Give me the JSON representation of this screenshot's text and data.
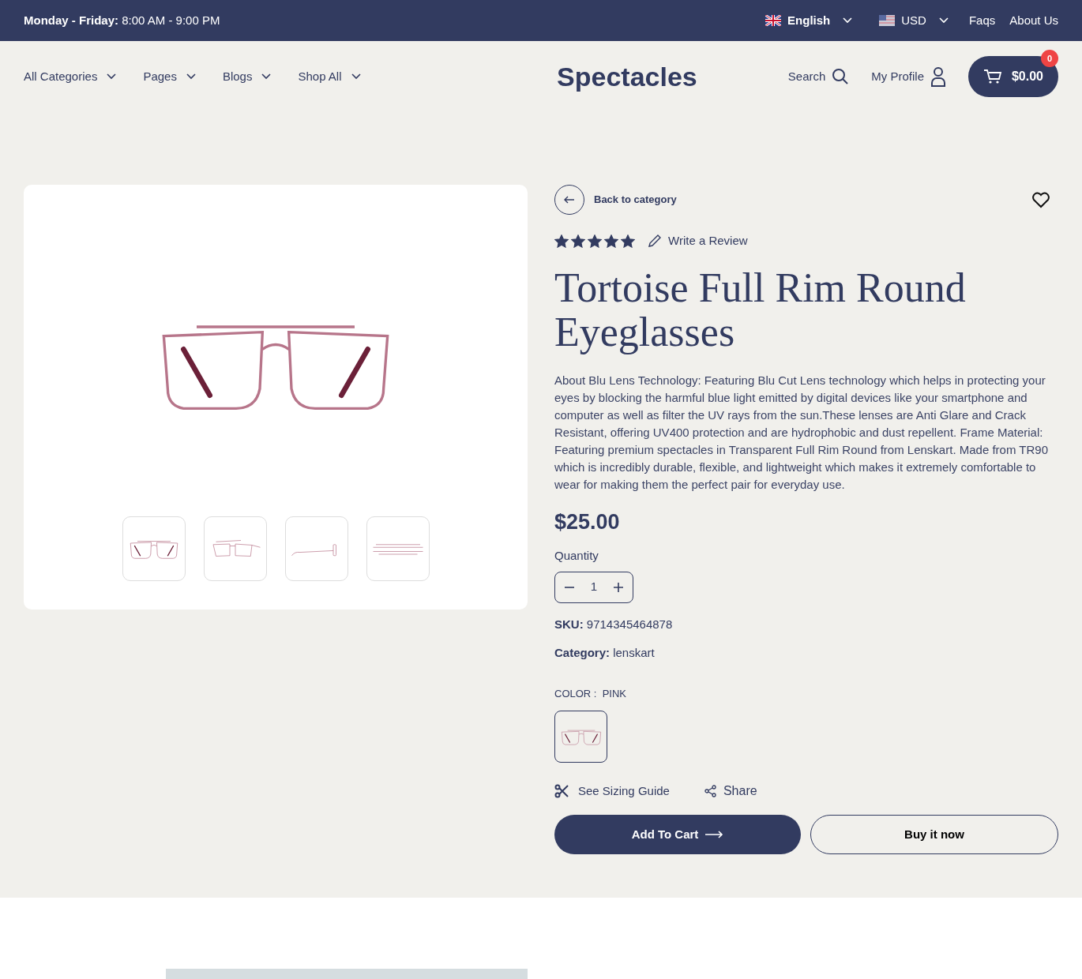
{
  "top_bar": {
    "hours_label": "Monday - Friday:",
    "hours": "8:00 AM - 9:00 PM",
    "language": "English",
    "currency": "USD",
    "links": [
      "Faqs",
      "About Us"
    ]
  },
  "nav": {
    "items": [
      "All Categories",
      "Pages",
      "Blogs",
      "Shop All"
    ],
    "logo": "Spectacles",
    "search": "Search",
    "profile": "My Profile",
    "cart_total": "$0.00",
    "cart_count": "0"
  },
  "gallery": {
    "thumbnails": [
      {
        "kind": "front"
      },
      {
        "kind": "angle"
      },
      {
        "kind": "side"
      },
      {
        "kind": "top"
      }
    ]
  },
  "product": {
    "back": "Back to category",
    "stars": 5,
    "review": "Write a Review",
    "title": "Tortoise Full Rim Round Eyeglasses",
    "description": "About Blu Lens Technology: Featuring Blu Cut Lens technology which helps in protecting your eyes by blocking the harmful blue light emitted by digital devices like your smartphone and computer as well as filter the UV rays from the sun.These lenses are Anti Glare and Crack Resistant, offering UV400 protection and are hydrophobic and dust repellent. Frame Material: Featuring premium spectacles in Transparent Full Rim Round from Lenskart. Made from TR90 which is incredibly durable, flexible, and lightweight which makes it extremely comfortable to wear for making them the perfect pair for everyday use.",
    "price": "$25.00",
    "quantity_label": "Quantity",
    "quantity": "1",
    "sku_label": "SKU:",
    "sku": "9714345464878",
    "category_label": "Category:",
    "category": "lenskart",
    "color_label": "COLOR :",
    "color_value": "PINK",
    "sizing": "See Sizing Guide",
    "share": "Share",
    "add_to_cart": "Add To Cart",
    "buy_now": "Buy it now"
  }
}
